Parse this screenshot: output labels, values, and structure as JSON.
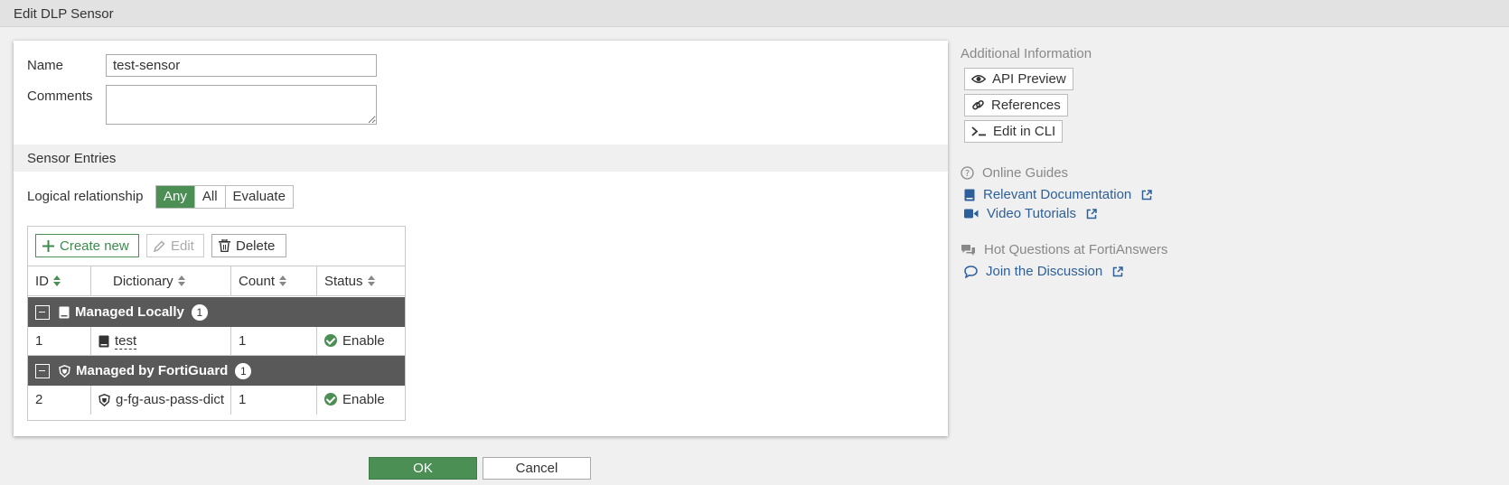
{
  "window": {
    "title": "Edit DLP Sensor"
  },
  "form": {
    "name_label": "Name",
    "name_value": "test-sensor",
    "comments_label": "Comments",
    "comments_value": ""
  },
  "sensor_entries": {
    "section_title": "Sensor Entries",
    "logical_label": "Logical relationship",
    "logical_options": [
      "Any",
      "All",
      "Evaluate"
    ],
    "logical_selected": "Any",
    "toolbar": {
      "create_label": "Create new",
      "edit_label": "Edit",
      "delete_label": "Delete"
    },
    "columns": [
      "ID",
      "Dictionary",
      "Count",
      "Status"
    ],
    "groups": [
      {
        "name": "Managed Locally",
        "count": "1",
        "rows": [
          {
            "id": "1",
            "dictionary": "test",
            "count": "1",
            "status": "Enable"
          }
        ]
      },
      {
        "name": "Managed by FortiGuard",
        "count": "1",
        "rows": [
          {
            "id": "2",
            "dictionary": "g-fg-aus-pass-dict",
            "count": "1",
            "status": "Enable"
          }
        ]
      }
    ]
  },
  "footer": {
    "ok_label": "OK",
    "cancel_label": "Cancel"
  },
  "sidebar": {
    "additional_title": "Additional Information",
    "buttons": [
      "API Preview",
      "References",
      "Edit in CLI"
    ],
    "guides_title": "Online Guides",
    "guide_links": [
      "Relevant Documentation",
      "Video Tutorials"
    ],
    "hot_title": "Hot Questions at FortiAnswers",
    "discussion_link": "Join the Discussion"
  },
  "colors": {
    "accent_green": "#4b8f55",
    "group_header": "#595959",
    "link_blue": "#2d5f9a"
  }
}
